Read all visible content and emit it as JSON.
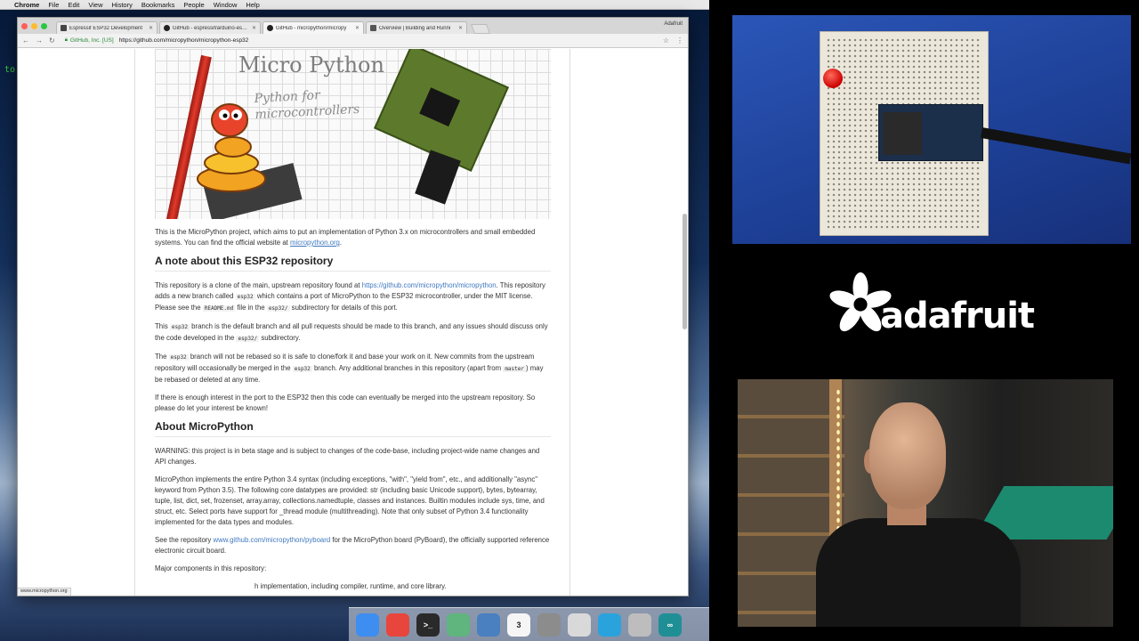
{
  "menubar": {
    "apple": "",
    "items": [
      "Chrome",
      "File",
      "Edit",
      "View",
      "History",
      "Bookmarks",
      "People",
      "Window",
      "Help"
    ]
  },
  "desktop": {
    "terminal_peek": "to"
  },
  "browser": {
    "profile": "Adafruit",
    "tabs": [
      {
        "label": "Espressif ESP32 Development",
        "active": false
      },
      {
        "label": "GitHub - espressif/arduino-esp32",
        "active": false
      },
      {
        "label": "GitHub - micropython/micropy",
        "active": true
      },
      {
        "label": "Overview | Building and Runni",
        "active": false
      }
    ],
    "toolbar": {
      "back": "←",
      "forward": "→",
      "reload": "↻",
      "ev_cert": "GitHub, Inc. [US]",
      "url": "https://github.com/micropython/micropython-esp32",
      "star": "☆",
      "menu": "⋮"
    },
    "status_url": "www.micropython.org"
  },
  "banner": {
    "title": "Micro Python",
    "subtitle_1": "Python for",
    "subtitle_2": "microcontrollers"
  },
  "readme": {
    "intro": {
      "text": "This is the MicroPython project, which aims to put an implementation of Python 3.x on microcontrollers and small embedded systems. You can find the official website at ",
      "link": "micropython.org",
      "end": "."
    },
    "h_note": "A note about this ESP32 repository",
    "p1": {
      "a": "This repository is a clone of the main, upstream repository found at ",
      "link": "https://github.com/micropython/micropython",
      "b": ". This repository adds a new branch called ",
      "code1": "esp32",
      "c": " which contains a port of MicroPython to the ESP32 microcontroller, under the MIT license. Please see the ",
      "code2": "README.md",
      "d": " file in the ",
      "code3": "esp32/",
      "e": " subdirectory for details of this port."
    },
    "p2": {
      "a": "This ",
      "code1": "esp32",
      "b": " branch is the default branch and all pull requests should be made to this branch, and any issues should discuss only the code developed in the ",
      "code2": "esp32/",
      "c": " subdirectory."
    },
    "p3": {
      "a": "The ",
      "code1": "esp32",
      "b": " branch will not be rebased so it is safe to clone/fork it and base your work on it. New commits from the upstream repository will occasionally be merged in the ",
      "code2": "esp32",
      "c": " branch. Any additional branches in this repository (apart from ",
      "code3": "master",
      "d": ") may be rebased or deleted at any time."
    },
    "p4": "If there is enough interest in the port to the ESP32 then this code can eventually be merged into the upstream repository. So please do let your interest be known!",
    "h_about": "About MicroPython",
    "p5": "WARNING: this project is in beta stage and is subject to changes of the code-base, including project-wide name changes and API changes.",
    "p6": "MicroPython implements the entire Python 3.4 syntax (including exceptions, \"with\", \"yield from\", etc., and additionally \"async\" keyword from Python 3.5). The following core datatypes are provided: str (including basic Unicode support), bytes, bytearray, tuple, list, dict, set, frozenset, array.array, collections.namedtuple, classes and instances. Builtin modules include sys, time, and struct, etc. Select ports have support for _thread module (multithreading). Note that only subset of Python 3.4 functionality implemented for the data types and modules.",
    "p7": {
      "a": "See the repository ",
      "link": "www.github.com/micropython/pyboard",
      "b": " for the MicroPython board (PyBoard), the officially supported reference electronic circuit board."
    },
    "p8": "Major components in this repository:",
    "p9_partial": "h implementation, including compiler, runtime, and core library."
  },
  "dock": {
    "icons": [
      {
        "name": "finder-icon",
        "color": "#3d8ef0",
        "glyph": ""
      },
      {
        "name": "chrome-icon",
        "color": "#e8453c",
        "glyph": ""
      },
      {
        "name": "terminal-icon",
        "color": "#2a2a2a",
        "glyph": ">_"
      },
      {
        "name": "atom-icon",
        "color": "#5fb57d",
        "glyph": ""
      },
      {
        "name": "network-icon",
        "color": "#4a7fc0",
        "glyph": ""
      },
      {
        "name": "calendar-icon",
        "color": "#f5f5f5",
        "glyph": "3"
      },
      {
        "name": "system-preferences-icon",
        "color": "#8c8c8c",
        "glyph": ""
      },
      {
        "name": "calculator-icon",
        "color": "#d9d9d9",
        "glyph": ""
      },
      {
        "name": "skype-icon",
        "color": "#2aa3dc",
        "glyph": ""
      },
      {
        "name": "disk-utility-icon",
        "color": "#bdbdbd",
        "glyph": ""
      },
      {
        "name": "arduino-icon",
        "color": "#1f8f96",
        "glyph": "∞"
      }
    ]
  },
  "branding": {
    "logo_text": "adafruit"
  }
}
